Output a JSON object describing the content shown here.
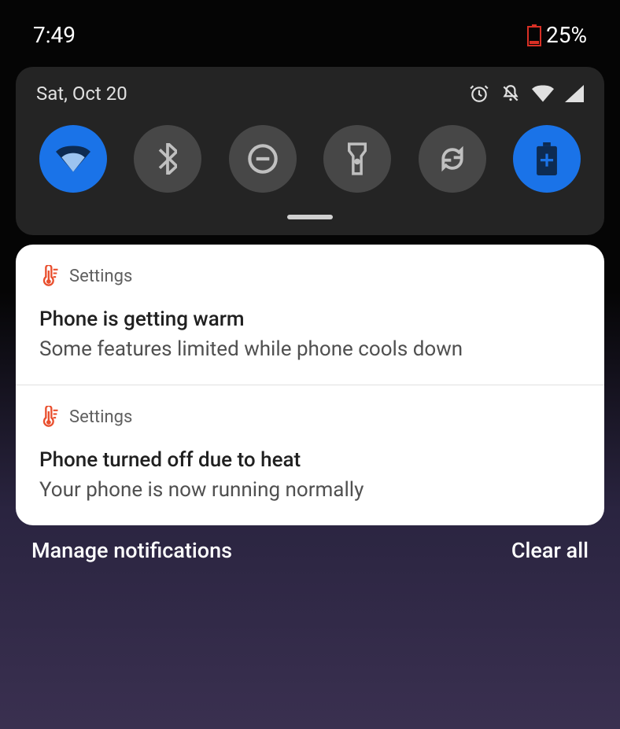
{
  "status_bar": {
    "time": "7:49",
    "battery_percent": "25%"
  },
  "quick_settings": {
    "date": "Sat, Oct 20",
    "header_icons": [
      "alarm-icon",
      "dnd-off-icon",
      "wifi-icon",
      "signal-icon"
    ],
    "tiles": [
      {
        "name": "wifi-tile",
        "active": true
      },
      {
        "name": "bluetooth-tile",
        "active": false
      },
      {
        "name": "do-not-disturb-tile",
        "active": false
      },
      {
        "name": "flashlight-tile",
        "active": false
      },
      {
        "name": "auto-rotate-tile",
        "active": false
      },
      {
        "name": "battery-saver-tile",
        "active": true
      }
    ]
  },
  "notifications": [
    {
      "app": "Settings",
      "title": "Phone is getting warm",
      "text": "Some features limited while phone cools down"
    },
    {
      "app": "Settings",
      "title": "Phone turned off due to heat",
      "text": "Your phone is now running normally"
    }
  ],
  "footer": {
    "manage": "Manage notifications",
    "clear": "Clear all"
  }
}
